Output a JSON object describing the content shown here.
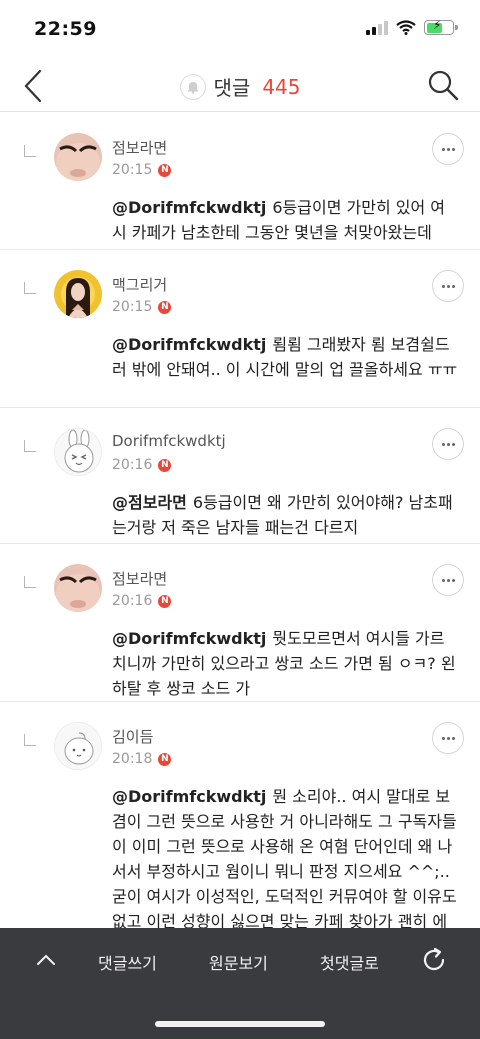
{
  "status_bar": {
    "time": "22:59"
  },
  "header": {
    "title": "댓글",
    "count": "445"
  },
  "comments": [
    {
      "author": "점보라면",
      "time": "20:15",
      "badge": "N",
      "mention": "@Dorifmfckwdktj",
      "text": "6등급이면 가만히 있어 여시 카페가 남초한테 그동안 몇년을 처맞아왔는데",
      "avatar": "avatar-face-closeup"
    },
    {
      "author": "맥그리거",
      "time": "20:15",
      "badge": "N",
      "mention": "@Dorifmfckwdktj",
      "text": "룀룀 그래봤자 룀 보겸쉴드러 밖에 안돼여.. 이 시간에 말의 업 끌올하세요 ㅠㅠ",
      "avatar": "avatar-portrait-yellow"
    },
    {
      "author": "Dorifmfckwdktj",
      "time": "20:16",
      "badge": "N",
      "mention": "@점보라면",
      "text": "6등급이면 왜 가만히 있어야해? 남초패는거랑 저 죽은 남자들 패는건 다르지",
      "avatar": "avatar-bunny-character"
    },
    {
      "author": "점보라면",
      "time": "20:16",
      "badge": "N",
      "mention": "@Dorifmfckwdktj",
      "text": "뭣도모르면서 여시들 가르치니까 가만히 있으라고 쌍코 소드 가면 됨 ㅇㅋ? 왼하탈 후 쌍코 소드 가",
      "avatar": "avatar-face-closeup"
    },
    {
      "author": "김이듬",
      "time": "20:18",
      "badge": "N",
      "mention": "@Dorifmfckwdktj",
      "text": "뭔 소리야.. 여시 말대로 보겸이 그런 뜻으로 사용한 거 아니라해도 그 구독자들이 이미 그런 뜻으로 사용해 온 여혐 단어인데 왜 나서서 부정하시고 웜이니 뭐니 판정 지으세요 ^^;.. 굳이 여시가 이성적인, 도덕적인 커뮤여야 할 이유도 없고 이런 성향이 싫으면 맞는 카페 찾아가 괜히 에너지 소비하지 말고 ㅋㅋ",
      "avatar": "avatar-default-character"
    }
  ],
  "toolbar": {
    "write_label": "댓글쓰기",
    "original_label": "원문보기",
    "first_label": "첫댓글로"
  },
  "colors": {
    "accent": "#e8473a",
    "toolbar_bg": "#3a3b3f"
  }
}
